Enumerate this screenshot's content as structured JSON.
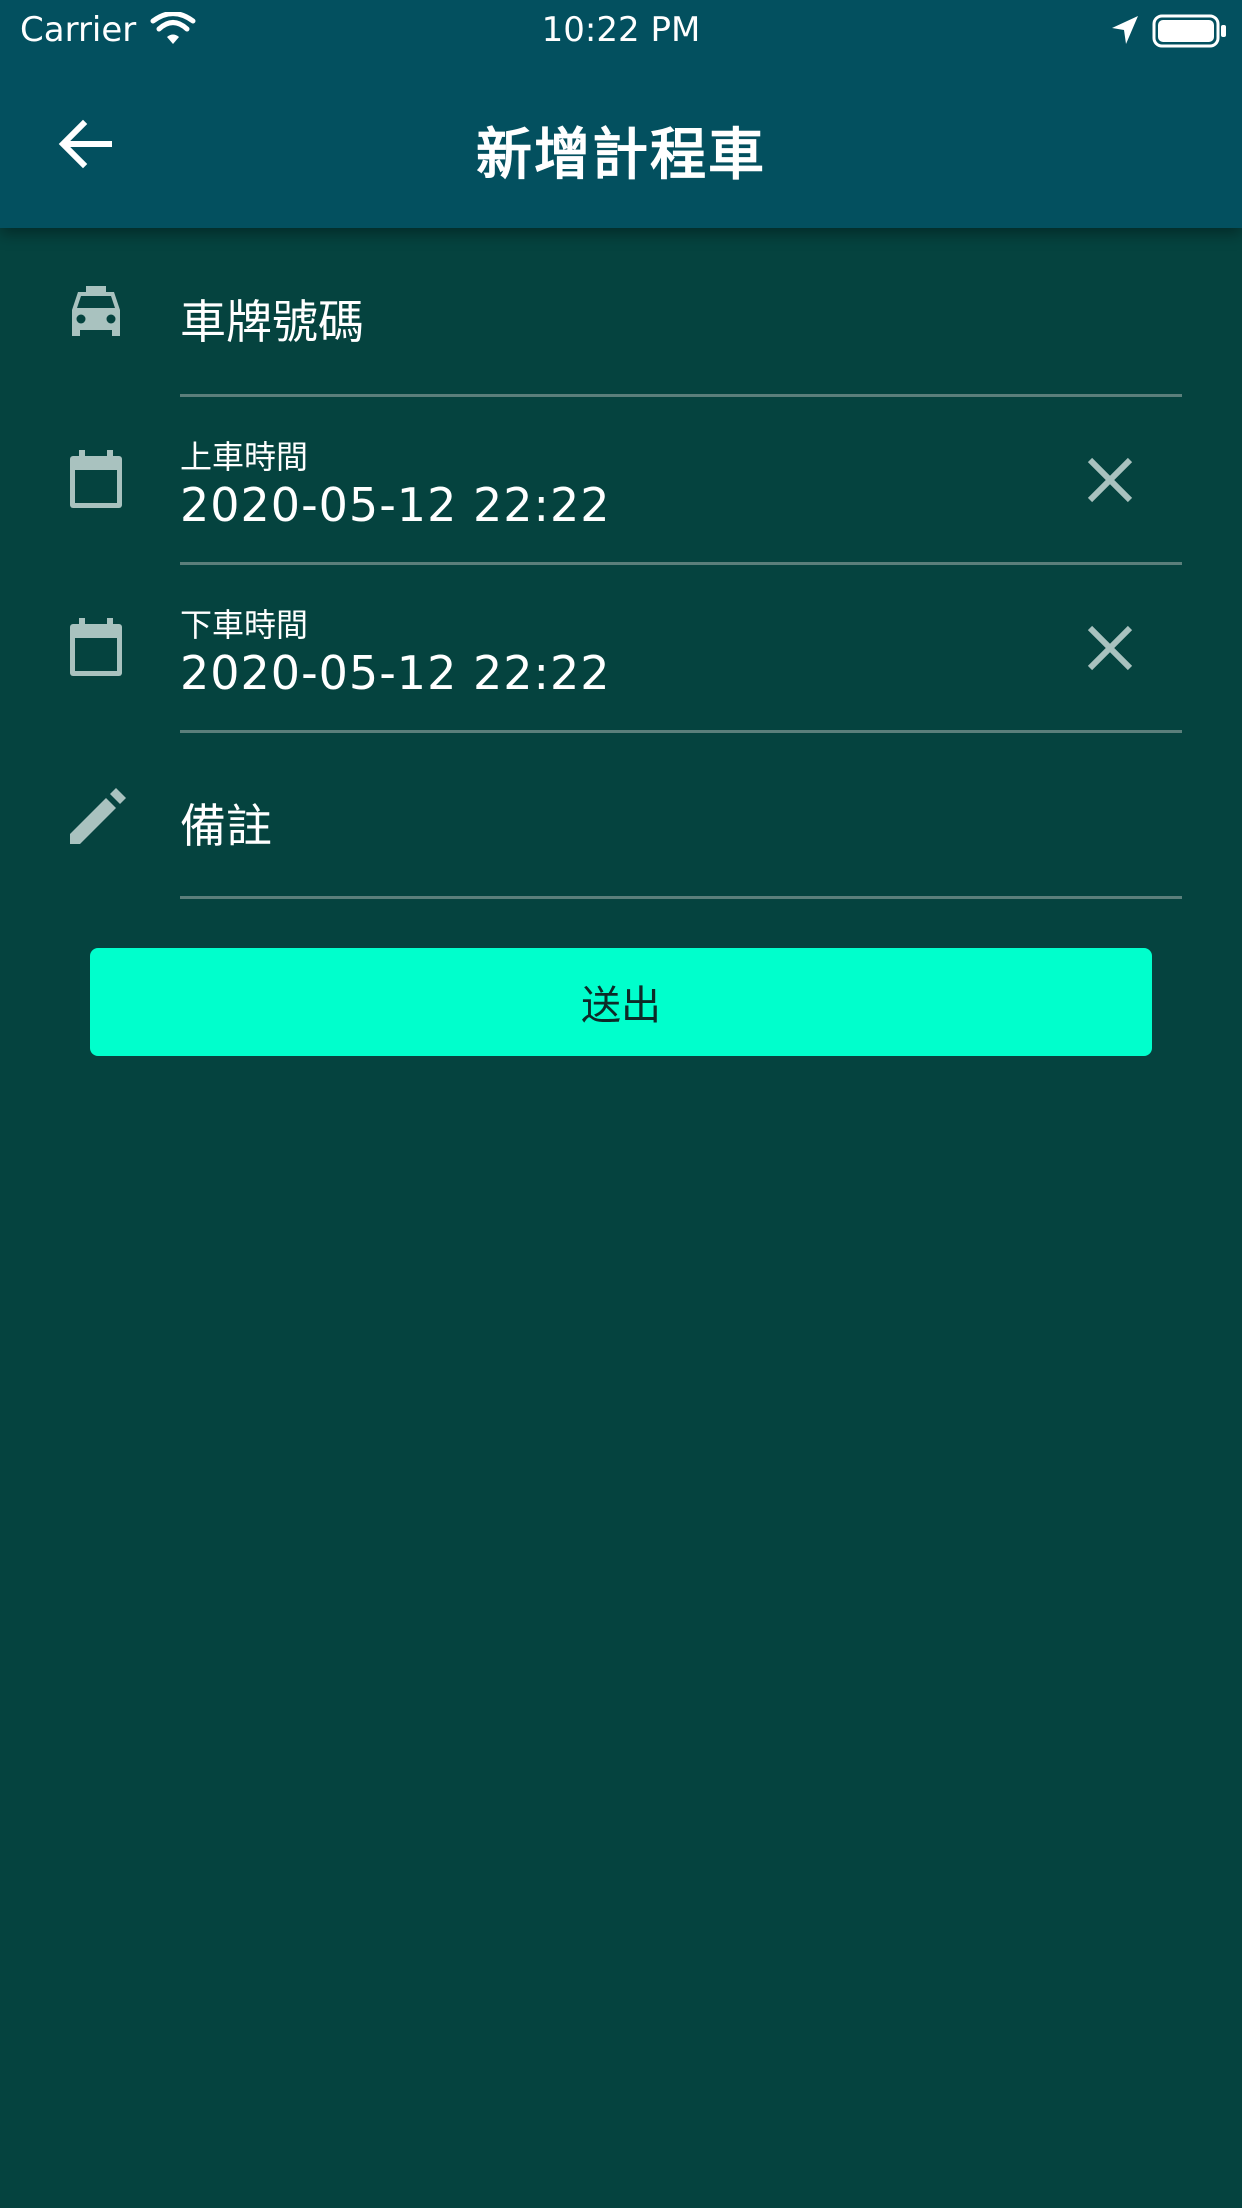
{
  "status_bar": {
    "carrier": "Carrier",
    "time": "10:22 PM"
  },
  "app_bar": {
    "title": "新增計程車",
    "back_icon": "arrow-back-icon"
  },
  "form": {
    "plate": {
      "icon": "taxi-icon",
      "placeholder": "車牌號碼"
    },
    "pickup_time": {
      "icon": "calendar-icon",
      "label": "上車時間",
      "value": "2020-05-12 22:22",
      "clear_icon": "close-icon"
    },
    "dropoff_time": {
      "icon": "calendar-icon",
      "label": "下車時間",
      "value": "2020-05-12 22:22",
      "clear_icon": "close-icon"
    },
    "note": {
      "icon": "pencil-icon",
      "placeholder": "備註"
    },
    "submit_label": "送出"
  },
  "colors": {
    "header_bg": "#03505f",
    "page_bg": "#05433f",
    "accent": "#00ffcc",
    "icon": "#a9c2bf",
    "divider": "#5b7f7b"
  }
}
